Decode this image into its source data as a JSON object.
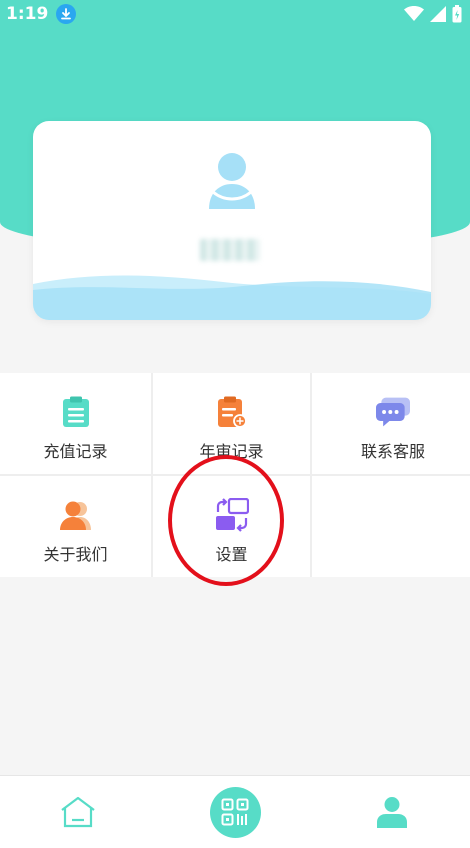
{
  "status_bar": {
    "time": "1:19"
  },
  "profile": {
    "username": ""
  },
  "menu": {
    "items": [
      {
        "label": "充值记录",
        "icon": "clipboard-icon"
      },
      {
        "label": "年审记录",
        "icon": "review-doc-icon"
      },
      {
        "label": "联系客服",
        "icon": "chat-icon"
      },
      {
        "label": "关于我们",
        "icon": "person-icon"
      },
      {
        "label": "设置",
        "icon": "settings-switch-icon"
      }
    ]
  },
  "bottom_nav": {
    "items": [
      {
        "icon": "home-icon"
      },
      {
        "icon": "qr-scan-icon"
      },
      {
        "icon": "profile-icon"
      }
    ]
  },
  "colors": {
    "accent": "#57dcc7",
    "highlight": "#e3101b",
    "wave": "#a6e0f7"
  }
}
